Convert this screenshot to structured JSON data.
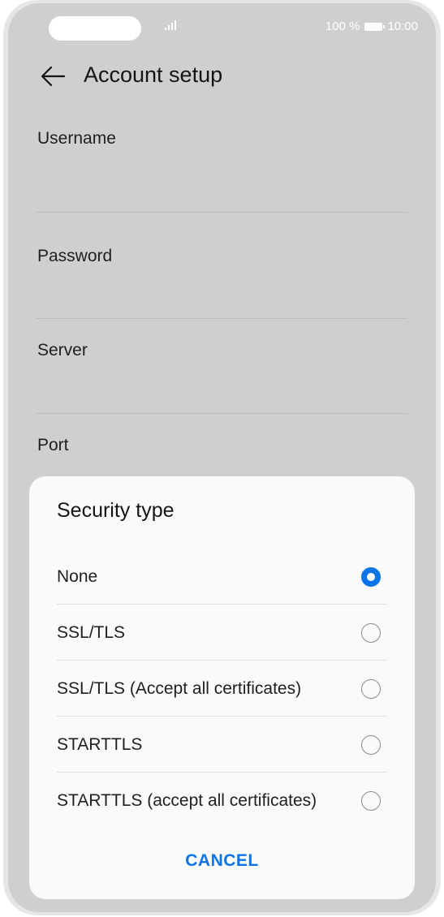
{
  "status_bar": {
    "battery_text": "100 %",
    "time": "10:00",
    "signal_icon": "signal-icon",
    "battery_icon": "battery-icon"
  },
  "header": {
    "back_icon": "arrow-left-icon",
    "title": "Account setup"
  },
  "form": {
    "fields": [
      {
        "label": "Username"
      },
      {
        "label": "Password"
      },
      {
        "label": "Server"
      },
      {
        "label": "Port"
      }
    ]
  },
  "dialog": {
    "title": "Security type",
    "options": [
      {
        "label": "None",
        "selected": true
      },
      {
        "label": "SSL/TLS",
        "selected": false
      },
      {
        "label": "SSL/TLS (Accept all certificates)",
        "selected": false
      },
      {
        "label": "STARTTLS",
        "selected": false
      },
      {
        "label": "STARTTLS (accept all certificates)",
        "selected": false
      }
    ],
    "cancel_label": "CANCEL"
  },
  "colors": {
    "accent": "#0a74e8",
    "dim_background": "#cfcfcf",
    "dialog_background": "#fafafa"
  }
}
